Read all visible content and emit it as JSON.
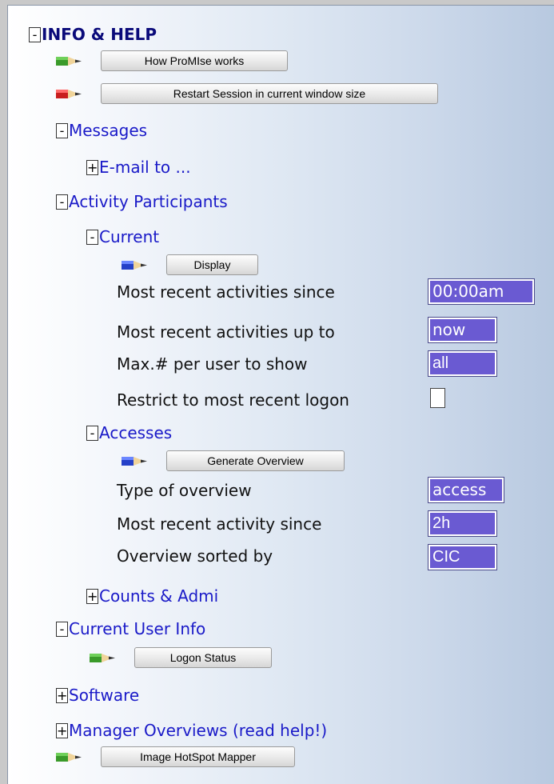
{
  "tree": {
    "root": {
      "toggle": "-",
      "label": "INFO & HELP"
    },
    "how_works_button": "How ProMIse works",
    "restart_button": "Restart Session in current window size",
    "messages": {
      "toggle": "-",
      "label": "Messages"
    },
    "email": {
      "toggle": "+",
      "label": "E-mail to ..."
    },
    "activity": {
      "toggle": "-",
      "label": "Activity Participants"
    },
    "current": {
      "toggle": "-",
      "label": "Current"
    },
    "display_button": "Display",
    "current_fields": {
      "since": {
        "label": "Most recent activities since",
        "value": "00:00am"
      },
      "upto": {
        "label": "Most recent activities up to",
        "value": "now"
      },
      "max": {
        "label": "Max.# per user to show",
        "value": "all"
      },
      "restrict": {
        "label": "Restrict to most recent logon",
        "checked": false
      }
    },
    "accesses": {
      "toggle": "-",
      "label": "Accesses"
    },
    "overview_button": "Generate Overview",
    "access_fields": {
      "type": {
        "label": "Type of overview",
        "value": "access"
      },
      "since": {
        "label": "Most recent activity since",
        "value": "2h"
      },
      "sorted": {
        "label": "Overview sorted by",
        "value": "CIC"
      }
    },
    "counts": {
      "toggle": "+",
      "label": "Counts & Admi"
    },
    "user_info": {
      "toggle": "-",
      "label": "Current User Info"
    },
    "logon_button": "Logon Status",
    "software": {
      "toggle": "+",
      "label": "Software"
    },
    "manager": {
      "toggle": "+",
      "label": "Manager Overviews (read help!)"
    },
    "hotspot_button": "Image HotSpot Mapper"
  },
  "icons": {
    "green": "green-pencil-icon",
    "red": "red-pencil-icon",
    "blue": "blue-pencil-icon"
  },
  "colors": {
    "link": "#1a1ac8",
    "field": "#6a5ad2",
    "pencil_green": "#3a9a2a",
    "pencil_red": "#c81e1e",
    "pencil_blue": "#2540c8"
  }
}
